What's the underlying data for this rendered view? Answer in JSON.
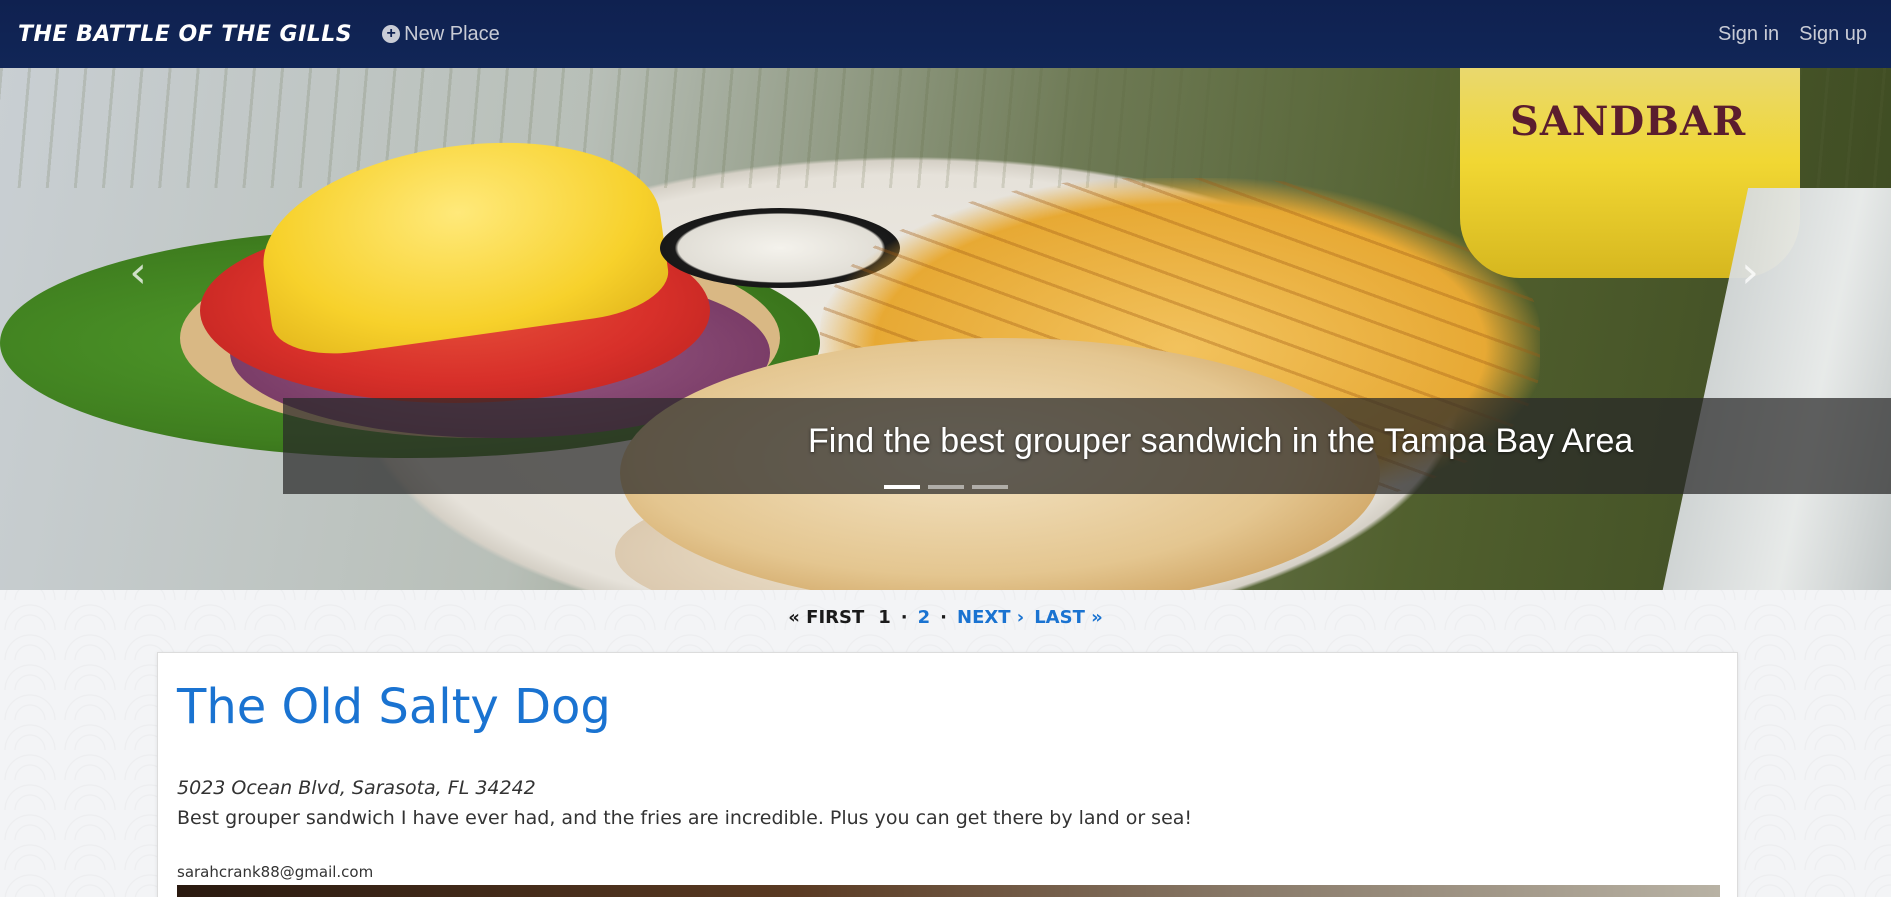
{
  "navbar": {
    "brand": "The Battle of the Gills",
    "new_place_label": "New Place",
    "sign_in_label": "Sign in",
    "sign_up_label": "Sign up"
  },
  "carousel": {
    "caption": "Find the best grouper sandwich in the Tampa Bay Area",
    "beer_brand": "SANDBAR",
    "prev_icon": "chevron-left-icon",
    "next_icon": "chevron-right-icon",
    "slides": 3,
    "active_slide": 1
  },
  "pagination": {
    "first_label": "« First",
    "current_page": "1",
    "page_2": "2",
    "next_label": "Next ›",
    "last_label": "Last »"
  },
  "place": {
    "name": "The Old Salty Dog",
    "address": "5023 Ocean Blvd, Sarasota, FL 34242",
    "description": "Best grouper sandwich I have ever had, and the fries are incredible. Plus you can get there by land or sea!",
    "email": "sarahcrank88@gmail.com"
  },
  "colors": {
    "navbar_bg": "#0f2150",
    "link_blue": "#1a73d1"
  }
}
